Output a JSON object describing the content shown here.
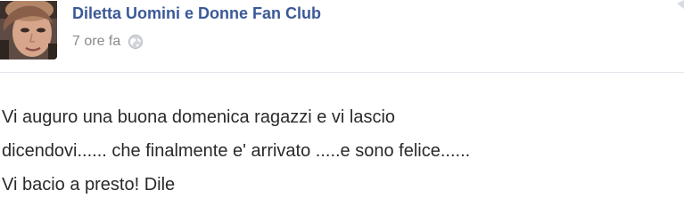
{
  "post": {
    "author_name": "Diletta Uomini e Donne Fan Club",
    "timestamp": "7 ore fa",
    "privacy_icon": "globe-icon",
    "message": "Vi auguro una buona domenica ragazzi e vi lascio\ndicendovi...... che finalmente e' arrivato .....e sono felice......\nVi bacio a presto! Dile"
  },
  "colors": {
    "author_link": "#3b5998",
    "timestamp": "#8a8a8a",
    "message_text": "#2a2a2a",
    "divider": "#e3e6ec"
  }
}
